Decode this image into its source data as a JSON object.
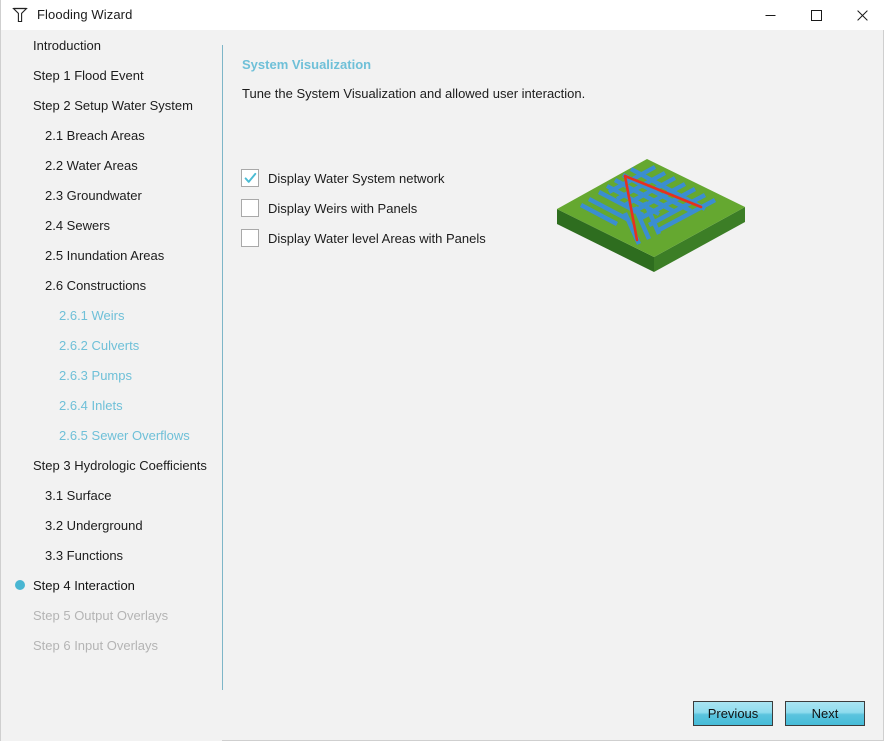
{
  "window": {
    "title": "Flooding Wizard",
    "icon": "weir-structure-icon",
    "controls": {
      "minimize": "minimize-icon",
      "maximize": "maximize-icon",
      "close": "close-icon"
    }
  },
  "sidebar": {
    "items": [
      {
        "label": "Introduction",
        "level": 0,
        "state": "normal",
        "bullet": false
      },
      {
        "label": "Step 1 Flood Event",
        "level": 0,
        "state": "normal",
        "bullet": false
      },
      {
        "label": "Step 2 Setup Water System",
        "level": 0,
        "state": "normal",
        "bullet": false
      },
      {
        "label": "2.1 Breach Areas",
        "level": 1,
        "state": "normal",
        "bullet": false
      },
      {
        "label": "2.2 Water Areas",
        "level": 1,
        "state": "normal",
        "bullet": false
      },
      {
        "label": "2.3 Groundwater",
        "level": 1,
        "state": "normal",
        "bullet": false
      },
      {
        "label": "2.4 Sewers",
        "level": 1,
        "state": "normal",
        "bullet": false
      },
      {
        "label": "2.5 Inundation Areas",
        "level": 1,
        "state": "normal",
        "bullet": false
      },
      {
        "label": "2.6 Constructions",
        "level": 1,
        "state": "normal",
        "bullet": false
      },
      {
        "label": "2.6.1 Weirs",
        "level": 2,
        "state": "link",
        "bullet": false
      },
      {
        "label": "2.6.2 Culverts",
        "level": 2,
        "state": "link",
        "bullet": false
      },
      {
        "label": "2.6.3 Pumps",
        "level": 2,
        "state": "link",
        "bullet": false
      },
      {
        "label": "2.6.4 Inlets",
        "level": 2,
        "state": "link",
        "bullet": false
      },
      {
        "label": "2.6.5 Sewer Overflows",
        "level": 2,
        "state": "link",
        "bullet": false
      },
      {
        "label": "Step 3 Hydrologic Coefficients",
        "level": 0,
        "state": "normal",
        "bullet": false
      },
      {
        "label": "3.1 Surface",
        "level": 1,
        "state": "normal",
        "bullet": false
      },
      {
        "label": "3.2 Underground",
        "level": 1,
        "state": "normal",
        "bullet": false
      },
      {
        "label": "3.3 Functions",
        "level": 1,
        "state": "normal",
        "bullet": false
      },
      {
        "label": "Step 4 Interaction",
        "level": 0,
        "state": "active",
        "bullet": true
      },
      {
        "label": "Step 5 Output Overlays",
        "level": 0,
        "state": "disabled",
        "bullet": false
      },
      {
        "label": "Step 6 Input Overlays",
        "level": 0,
        "state": "disabled",
        "bullet": false
      }
    ]
  },
  "main": {
    "title": "System Visualization",
    "subtitle": "Tune the System Visualization and allowed user interaction.",
    "options": [
      {
        "label": "Display Water System network",
        "checked": true
      },
      {
        "label": "Display Weirs with Panels",
        "checked": false
      },
      {
        "label": "Display Water level Areas with Panels",
        "checked": false
      }
    ],
    "visualization": {
      "name": "water-system-3d-preview",
      "terrain_top_color": "#65a830",
      "terrain_side_color": "#2e6d1f",
      "channel_color": "#3b8ed0",
      "network_color": "#e6301f"
    }
  },
  "footer": {
    "previous_label": "Previous",
    "next_label": "Next"
  },
  "colors": {
    "accent": "#6fc0d8",
    "bullet": "#49b6d2",
    "divider": "#7eb6c8",
    "disabled_text": "#b4b4b4",
    "window_bg": "#f2f2f2",
    "titlebar_bg": "#ffffff",
    "button_gradient_top": "#a9e4f2",
    "button_gradient_bottom": "#46bcd8"
  }
}
